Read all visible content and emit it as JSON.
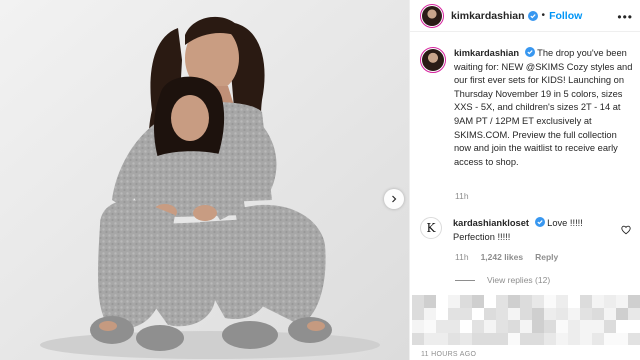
{
  "header": {
    "username": "kimkardashian",
    "separator": "•",
    "follow_label": "Follow",
    "more_icon": "more-options-icon"
  },
  "caption": {
    "username": "kimkardashian",
    "text": "The drop you've been waiting for: NEW @SKIMS Cozy styles and our first ever sets for KIDS! Launching on Thursday November 19 in 5 colors, sizes XXS - 5X, and children's sizes 2T - 14 at 9AM PT / 12PM ET exclusively at SKIMS.COM. Preview the full collection now and join the waitlist to receive early access to shop.",
    "time": "11h"
  },
  "comment": {
    "avatar_letter": "K",
    "username": "kardashiankloset",
    "text": "Love !!!!! Perfection !!!!!",
    "time": "11h",
    "likes": "1,242 likes",
    "reply_label": "Reply",
    "view_replies": "View replies (12)"
  },
  "footer": {
    "timestamp": "11 HOURS AGO"
  },
  "colors": {
    "accent_blue": "#0095f6",
    "verified_blue": "#3897f0",
    "muted_text": "#8e8e8e",
    "fabric_gray": "#a8a8a8"
  },
  "icons": [
    "verified-badge-icon",
    "more-options-icon",
    "heart-icon",
    "next-arrow-icon"
  ]
}
